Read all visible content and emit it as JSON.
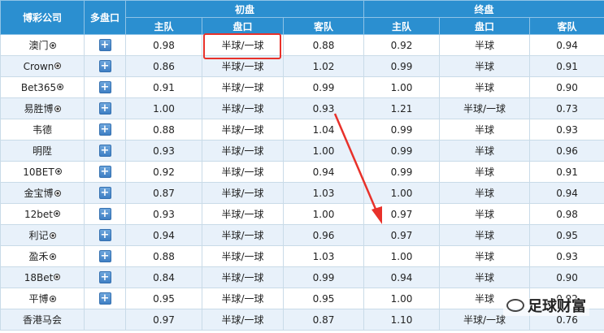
{
  "header": {
    "company": "博彩公司",
    "multi": "多盘口",
    "initial_group": "初盘",
    "final_group": "终盘",
    "home": "主队",
    "line": "盘口",
    "away": "客队"
  },
  "rows": [
    {
      "company": "澳门",
      "ball": true,
      "plus": true,
      "i_home": "0.98",
      "i_line": "半球/一球",
      "i_away": "0.88",
      "f_home": "0.92",
      "f_line": "半球",
      "f_away": "0.94"
    },
    {
      "company": "Crown",
      "ball": true,
      "plus": true,
      "i_home": "0.86",
      "i_line": "半球/一球",
      "i_away": "1.02",
      "f_home": "0.99",
      "f_line": "半球",
      "f_away": "0.91"
    },
    {
      "company": "Bet365",
      "ball": true,
      "plus": true,
      "i_home": "0.91",
      "i_line": "半球/一球",
      "i_away": "0.99",
      "f_home": "1.00",
      "f_line": "半球",
      "f_away": "0.90"
    },
    {
      "company": "易胜博",
      "ball": true,
      "plus": true,
      "i_home": "1.00",
      "i_line": "半球/一球",
      "i_away": "0.93",
      "f_home": "1.21",
      "f_line": "半球/一球",
      "f_away": "0.73"
    },
    {
      "company": "韦德",
      "ball": false,
      "plus": true,
      "i_home": "0.88",
      "i_line": "半球/一球",
      "i_away": "1.04",
      "f_home": "0.99",
      "f_line": "半球",
      "f_away": "0.93"
    },
    {
      "company": "明陞",
      "ball": false,
      "plus": true,
      "i_home": "0.93",
      "i_line": "半球/一球",
      "i_away": "1.00",
      "f_home": "0.99",
      "f_line": "半球",
      "f_away": "0.96"
    },
    {
      "company": "10BET",
      "ball": true,
      "plus": true,
      "i_home": "0.92",
      "i_line": "半球/一球",
      "i_away": "0.94",
      "f_home": "0.99",
      "f_line": "半球",
      "f_away": "0.91"
    },
    {
      "company": "金宝博",
      "ball": true,
      "plus": true,
      "i_home": "0.87",
      "i_line": "半球/一球",
      "i_away": "1.03",
      "f_home": "1.00",
      "f_line": "半球",
      "f_away": "0.94"
    },
    {
      "company": "12bet",
      "ball": true,
      "plus": true,
      "i_home": "0.93",
      "i_line": "半球/一球",
      "i_away": "1.00",
      "f_home": "0.97",
      "f_line": "半球",
      "f_away": "0.98"
    },
    {
      "company": "利记",
      "ball": true,
      "plus": true,
      "i_home": "0.94",
      "i_line": "半球/一球",
      "i_away": "0.96",
      "f_home": "0.97",
      "f_line": "半球",
      "f_away": "0.95"
    },
    {
      "company": "盈禾",
      "ball": true,
      "plus": true,
      "i_home": "0.88",
      "i_line": "半球/一球",
      "i_away": "1.03",
      "f_home": "1.00",
      "f_line": "半球",
      "f_away": "0.93"
    },
    {
      "company": "18Bet",
      "ball": true,
      "plus": true,
      "i_home": "0.84",
      "i_line": "半球/一球",
      "i_away": "0.99",
      "f_home": "0.94",
      "f_line": "半球",
      "f_away": "0.90"
    },
    {
      "company": "平博",
      "ball": true,
      "plus": true,
      "i_home": "0.95",
      "i_line": "半球/一球",
      "i_away": "0.95",
      "f_home": "1.00",
      "f_line": "半球",
      "f_away": "0.92"
    },
    {
      "company": "香港马会",
      "ball": false,
      "plus": false,
      "i_home": "0.97",
      "i_line": "半球/一球",
      "i_away": "0.87",
      "f_home": "1.10",
      "f_line": "半球/一球",
      "f_away": "0.76"
    }
  ],
  "watermark": "足球财富",
  "colors": {
    "header_bg": "#2b8fd0",
    "row_alt_bg": "#e8f1fa",
    "highlight": "#e8312a",
    "plus_btn": "#4a8ad0"
  },
  "icons": {
    "ball": "soccer-ball-icon",
    "plus": "plus-icon"
  }
}
